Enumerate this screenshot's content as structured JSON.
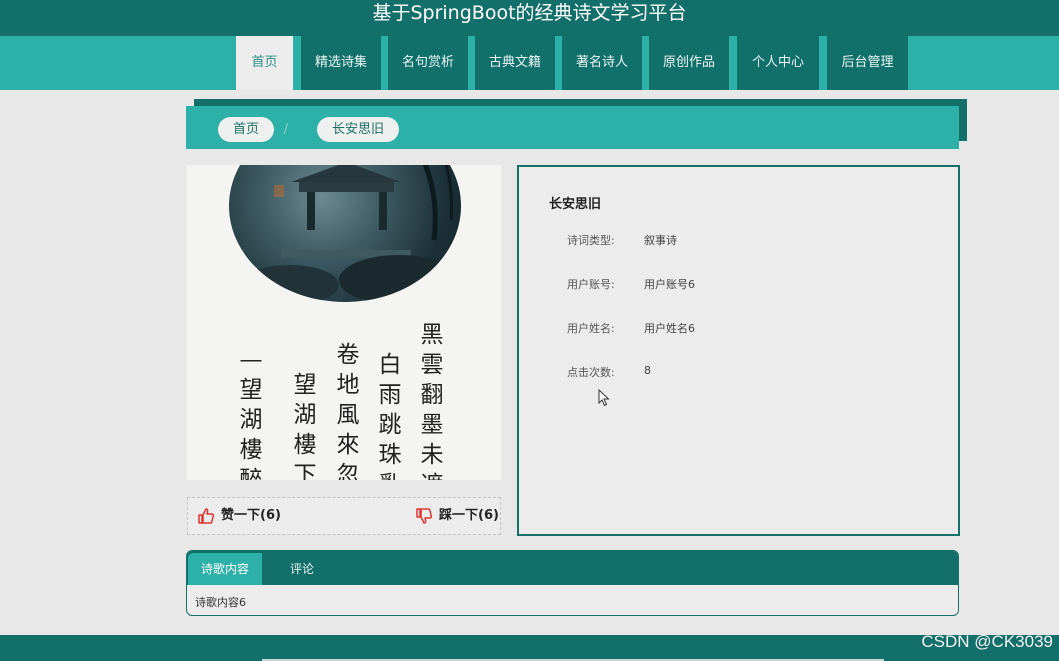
{
  "header": {
    "title": "基于SpringBoot的经典诗文学习平台"
  },
  "nav": {
    "items": [
      {
        "label": "首页"
      },
      {
        "label": "精选诗集"
      },
      {
        "label": "名句赏析"
      },
      {
        "label": "古典文籍"
      },
      {
        "label": "著名诗人"
      },
      {
        "label": "原创作品"
      },
      {
        "label": "个人中心"
      },
      {
        "label": "后台管理"
      }
    ]
  },
  "breadcrumb": {
    "home": "首页",
    "separator": "/",
    "current": "长安思旧"
  },
  "poster": {
    "columns": [
      "黑雲翻墨未遮",
      "白雨跳珠亂",
      "卷地風來忽",
      "望湖樓下",
      "—望湖樓醉書"
    ]
  },
  "votes": {
    "like_label": "赞一下(6)",
    "dislike_label": "踩一下(6)"
  },
  "detail": {
    "title": "长安思旧",
    "fields": [
      {
        "label": "诗词类型:",
        "value": "叙事诗"
      },
      {
        "label": "用户账号:",
        "value": "用户账号6"
      },
      {
        "label": "用户姓名:",
        "value": "用户姓名6"
      },
      {
        "label": "点击次数:",
        "value": "8"
      }
    ]
  },
  "tabs": {
    "items": [
      {
        "label": "诗歌内容"
      },
      {
        "label": "评论"
      }
    ],
    "content": "诗歌内容6"
  },
  "watermark": "CSDN @CK3039",
  "colors": {
    "primary_dark": "#136f69",
    "primary": "#2db0a8",
    "background": "#e8e8e8",
    "vote_icon": "#e0332d"
  }
}
